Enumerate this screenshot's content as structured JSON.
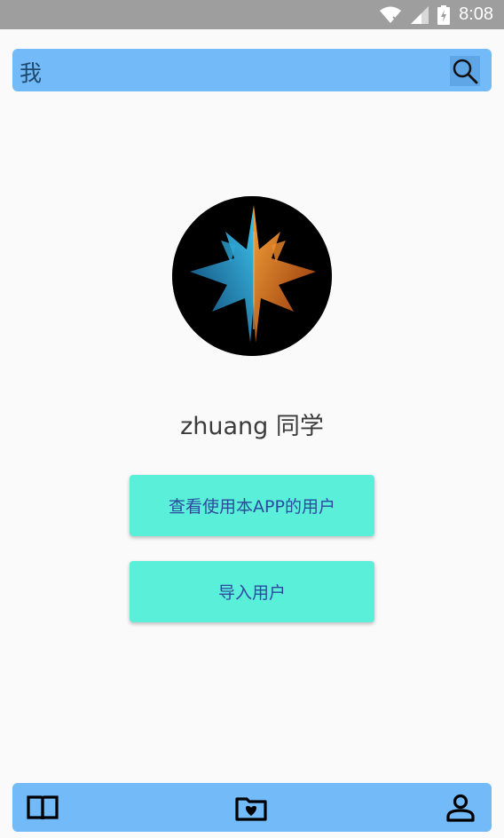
{
  "status_bar": {
    "time": "8:08"
  },
  "app_bar": {
    "title": "我",
    "search_icon": "search-icon"
  },
  "profile": {
    "username": "zhuang 同学"
  },
  "actions": {
    "view_users_label": "查看使用本APP的用户",
    "import_users_label": "导入用户"
  },
  "bottom_nav": {
    "items": [
      {
        "icon": "book-icon"
      },
      {
        "icon": "folder-heart-icon"
      },
      {
        "icon": "person-icon"
      }
    ]
  },
  "colors": {
    "app_bar": "#73baf8",
    "button": "#5aefd9",
    "status_bar": "#9e9e9e"
  }
}
